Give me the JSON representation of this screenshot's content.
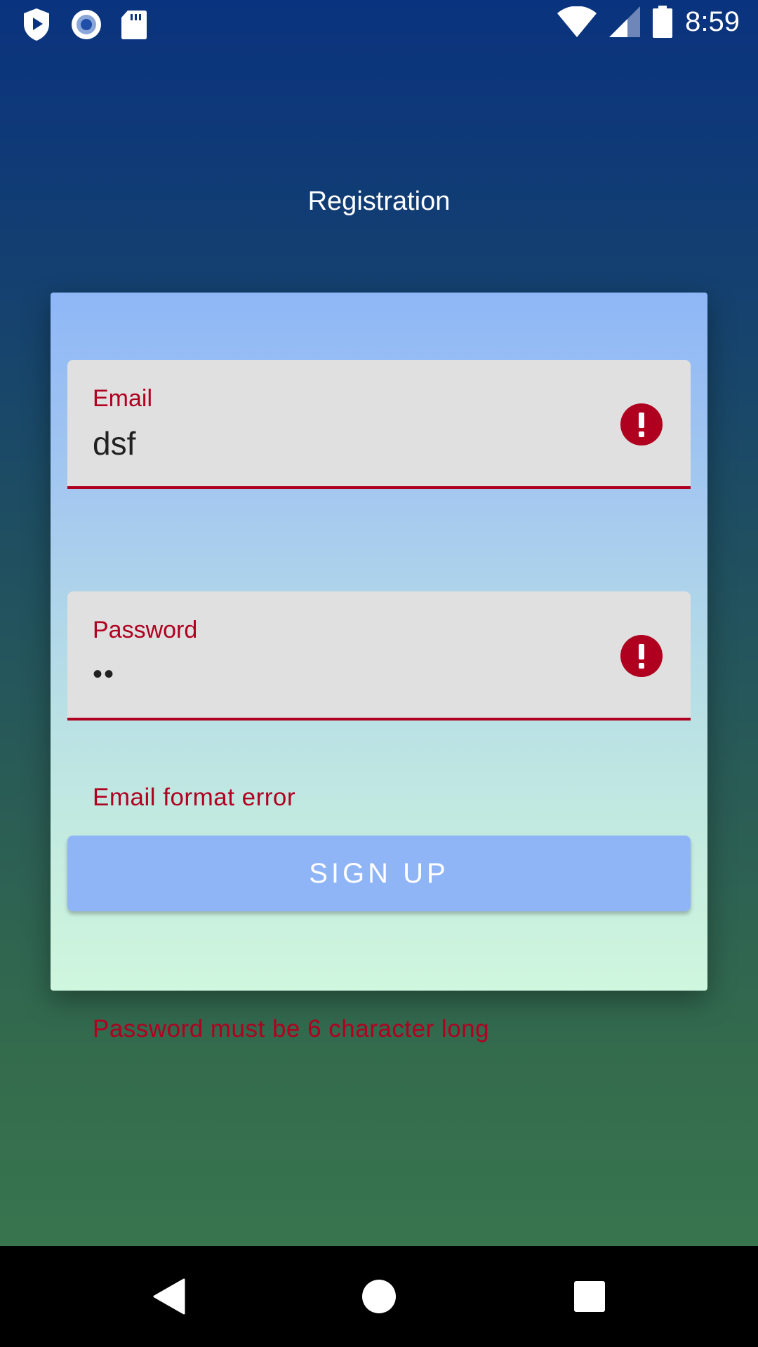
{
  "status_bar": {
    "time": "8:59",
    "icons_left": [
      "play-protect-icon",
      "radio-circle-icon",
      "sd-card-icon"
    ],
    "icons_right": [
      "wifi-icon",
      "cell-signal-icon",
      "battery-icon"
    ]
  },
  "page": {
    "title": "Registration"
  },
  "form": {
    "email": {
      "label": "Email",
      "value": "dsf",
      "error": "Email format error"
    },
    "password": {
      "label": "Password",
      "value": "••",
      "error": "Password must be 6 character long"
    },
    "signup_label": "SIGN UP"
  },
  "nav_bar": {
    "buttons": [
      "back-icon",
      "home-icon",
      "recents-icon"
    ]
  },
  "colors": {
    "error": "#b00020",
    "field_bg": "#e0e0e0",
    "button_bg": "#8fb5f6",
    "header_blue": "#0a337f",
    "footer_green": "#3b7a4e"
  }
}
